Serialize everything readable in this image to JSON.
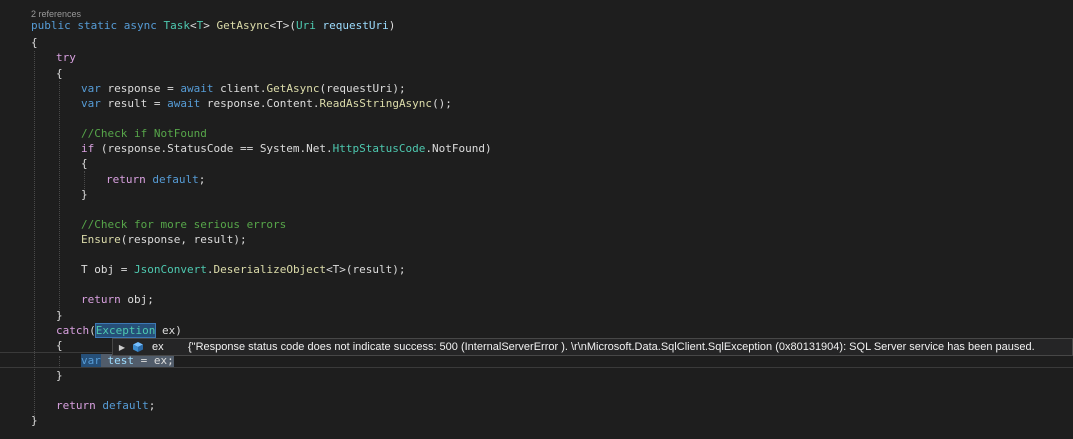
{
  "codelens": "2 references",
  "code": {
    "sig_public": "public",
    "sig_static": "static",
    "sig_async": "async",
    "sig_task": "Task",
    "sig_lt": "<",
    "sig_T": "T",
    "sig_gt": ">",
    "sig_method": "GetAsync",
    "sig_typeparam": "<T>",
    "sig_open_paren": "(",
    "sig_uri": "Uri",
    "sig_param": "requestUri",
    "sig_close_paren": ")",
    "brace_open": "{",
    "brace_close": "}",
    "try": "try",
    "var": "var",
    "response": "response",
    "eq": " = ",
    "await": "await",
    "client": "client",
    "dot": ".",
    "getasync": "GetAsync",
    "requestUri_call": "(requestUri);",
    "result": "result",
    "content": "response.Content.",
    "readasstring": "ReadAsStringAsync",
    "empty_call": "();",
    "comment1": "//Check if NotFound",
    "if": "if",
    "if_cond_a": " (response.StatusCode == System.Net.",
    "httpstatuscode": "HttpStatusCode",
    "if_cond_b": ".NotFound)",
    "return": "return",
    "default": "default",
    "semicolon": ";",
    "comment2": "//Check for more serious errors",
    "ensure": "Ensure",
    "ensure_args": "(response, result);",
    "t_obj": "T obj = ",
    "jsonconvert": "JsonConvert",
    "deserialize": "DeserializeObject",
    "generic_call": "<T>(result);",
    "return_obj": " obj;",
    "catch": "catch",
    "exception": "Exception",
    "catch_var": " ex)",
    "test": "test",
    "assign_ex": " = ex;",
    "return_default_tail": ";"
  },
  "datatip": {
    "name": "ex",
    "value": "{\"Response status code does not indicate success: 500 (InternalServerError ). \\r\\nMicrosoft.Data.SqlClient.SqlException (0x80131904): SQL Server service has been paused."
  },
  "colors": {
    "background": "#1e1e1e",
    "keyword": "#569cd6",
    "control": "#d8a0df",
    "type": "#4ec9b0",
    "method": "#dcdcaa",
    "comment": "#57a64a",
    "highlight": "#264f78"
  },
  "icons": {
    "expander": "triangle-right",
    "field": "blue-cube"
  }
}
